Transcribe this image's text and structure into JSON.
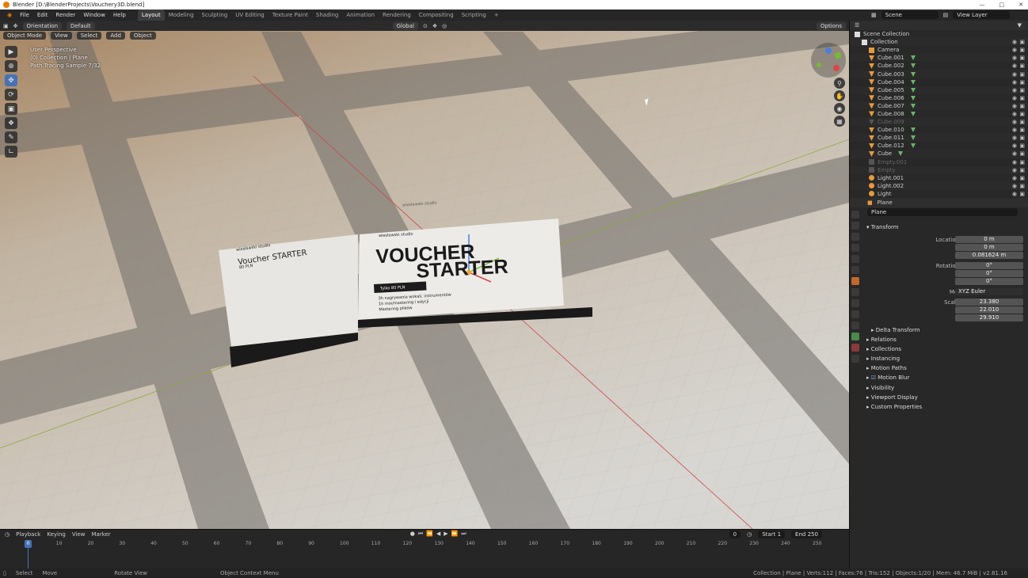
{
  "window": {
    "title": "Blender [D:\\BlenderProjects\\Vouchery3D.blend]"
  },
  "menu": [
    "File",
    "Edit",
    "Render",
    "Window",
    "Help"
  ],
  "workspaces": [
    "Layout",
    "Modeling",
    "Sculpting",
    "UV Editing",
    "Texture Paint",
    "Shading",
    "Animation",
    "Rendering",
    "Compositing",
    "Scripting"
  ],
  "active_workspace": "Layout",
  "scene": {
    "scene_label": "Scene",
    "view_layer_label": "View Layer"
  },
  "viewport_header": {
    "orientation": "Orientation",
    "default": "Default",
    "transform": "Global",
    "options": "Options"
  },
  "viewport_header2": {
    "mode": "Object Mode",
    "view": "View",
    "select": "Select",
    "add": "Add",
    "object": "Object"
  },
  "viewport_info": {
    "line1": "User Perspective",
    "line2": "(0) Collection | Plane",
    "line3": "Path Tracing Sample 7/32"
  },
  "voucher": {
    "brand": "wiesławski studio",
    "main_line1": "VOUCHER",
    "main_line2": "STARTER",
    "price": "Tylko 80 PLN",
    "bullets": [
      "3h nagrywania wokali, instrumentów",
      "1h mix/mastering i edycji",
      "Mastering plików"
    ],
    "left_title": "Voucher STARTER",
    "left_sub": "80 PLN"
  },
  "outliner": {
    "search_placeholder": "",
    "rows": [
      {
        "name": "Scene Collection",
        "level": 0,
        "type": "collection"
      },
      {
        "name": "Collection",
        "level": 1,
        "type": "collection"
      },
      {
        "name": "Camera",
        "level": 2,
        "type": "camera"
      },
      {
        "name": "Cube.001",
        "level": 2,
        "type": "mesh"
      },
      {
        "name": "Cube.002",
        "level": 2,
        "type": "mesh"
      },
      {
        "name": "Cube.003",
        "level": 2,
        "type": "mesh"
      },
      {
        "name": "Cube.004",
        "level": 2,
        "type": "mesh"
      },
      {
        "name": "Cube.005",
        "level": 2,
        "type": "mesh"
      },
      {
        "name": "Cube.006",
        "level": 2,
        "type": "mesh"
      },
      {
        "name": "Cube.007",
        "level": 2,
        "type": "mesh"
      },
      {
        "name": "Cube.008",
        "level": 2,
        "type": "mesh"
      },
      {
        "name": "Cube.009",
        "level": 2,
        "type": "mesh",
        "dim": true
      },
      {
        "name": "Cube.010",
        "level": 2,
        "type": "mesh"
      },
      {
        "name": "Cube.011",
        "level": 2,
        "type": "mesh"
      },
      {
        "name": "Cube.012",
        "level": 2,
        "type": "mesh"
      },
      {
        "name": "Cube",
        "level": 2,
        "type": "mesh"
      },
      {
        "name": "Empty.001",
        "level": 2,
        "type": "empty",
        "dim": true
      },
      {
        "name": "Empty",
        "level": 2,
        "type": "empty",
        "dim": true
      },
      {
        "name": "Light.001",
        "level": 2,
        "type": "light"
      },
      {
        "name": "Light.002",
        "level": 2,
        "type": "light"
      },
      {
        "name": "Light",
        "level": 2,
        "type": "light"
      }
    ]
  },
  "properties": {
    "object_name": "Plane",
    "data_name": "Plane",
    "transform_label": "Transform",
    "location": {
      "label": "Location X",
      "x": "0 m",
      "y": "0 m",
      "z": "0.081624 m"
    },
    "rotation": {
      "label": "Rotation X",
      "x": "0°",
      "y": "0°",
      "z": "0°"
    },
    "mode": {
      "label": "Mode",
      "value": "XYZ Euler"
    },
    "scale": {
      "label": "Scale X",
      "x": "23.380",
      "y": "22.010",
      "z": "29.910"
    },
    "axis_y": "Y",
    "axis_z": "Z",
    "sections": [
      "Delta Transform",
      "Relations",
      "Collections",
      "Instancing",
      "Motion Paths",
      "Motion Blur",
      "Visibility",
      "Viewport Display",
      "Custom Properties"
    ]
  },
  "timeline": {
    "playback": "Playback",
    "keying": "Keying",
    "view": "View",
    "marker": "Marker",
    "current_frame": "0",
    "start_label": "Start",
    "start": "1",
    "end_label": "End",
    "end": "250",
    "ticks": [
      "0",
      "10",
      "20",
      "30",
      "40",
      "50",
      "60",
      "70",
      "80",
      "90",
      "100",
      "110",
      "120",
      "130",
      "140",
      "150",
      "160",
      "170",
      "180",
      "190",
      "200",
      "210",
      "220",
      "230",
      "240",
      "250"
    ]
  },
  "statusbar": {
    "select": "Select",
    "move": "Move",
    "rotate": "Rotate View",
    "context": "Object Context Menu",
    "stats": "Collection | Plane | Verts:112 | Faces:76 | Tris:152 | Objects:1/20 | Mem: 46.7 MiB | v2.81.16"
  }
}
